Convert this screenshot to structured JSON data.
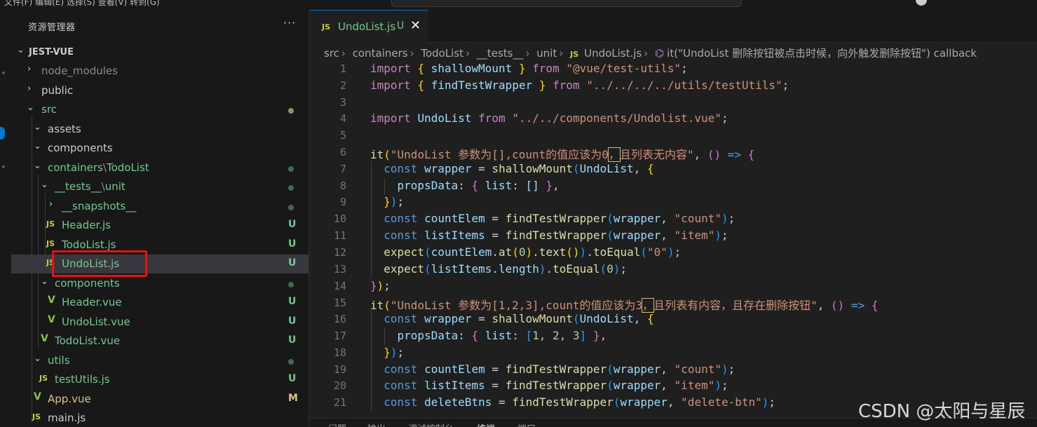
{
  "menubar": {
    "text": "文件(F)  编辑(E)  选择(S)  查看(V)  转到(G)"
  },
  "explorer": {
    "title": "资源管理器",
    "more": "···",
    "root": "JEST-VUE",
    "items": [
      {
        "label": "node_modules"
      },
      {
        "label": "public"
      },
      {
        "label": "src"
      },
      {
        "label": "assets"
      },
      {
        "label": "components"
      },
      {
        "label_a": "containers",
        "sep": "\\",
        "label_b": "TodoList"
      },
      {
        "label_a": "__tests__",
        "sep": "\\",
        "label_b": "unit"
      },
      {
        "label": "__snapshots__"
      },
      {
        "label": "Header.js",
        "status": "U"
      },
      {
        "label": "TodoList.js",
        "status": "U"
      },
      {
        "label": "UndoList.js",
        "status": "U"
      },
      {
        "label": "components"
      },
      {
        "label": "Header.vue",
        "status": "U"
      },
      {
        "label": "UndoList.vue",
        "status": "U"
      },
      {
        "label": "TodoList.vue",
        "status": "U"
      },
      {
        "label": "utils"
      },
      {
        "label": "testUtils.js",
        "status": "U"
      },
      {
        "label": "App.vue",
        "status": "M"
      },
      {
        "label": "main.js"
      }
    ],
    "js_icon": "JS",
    "vue_icon": "V"
  },
  "tab": {
    "icon": "JS",
    "name": "UndoList.js",
    "status": "U",
    "close": "✕"
  },
  "breadcrumb": {
    "parts": [
      "src",
      "containers",
      "TodoList",
      "__tests__",
      "unit"
    ],
    "file": "UndoList.js",
    "symbol": "it(\"UndoList 删除按钮被点击时候，向外触发删除按钮\") callback"
  },
  "code": {
    "line_numbers": [
      "1",
      "2",
      "3",
      "4",
      "5",
      "6",
      "7",
      "8",
      "9",
      "10",
      "11",
      "12",
      "13",
      "14",
      "15",
      "16",
      "17",
      "18",
      "19",
      "20",
      "21"
    ],
    "import": "import",
    "from": "from",
    "const": "const",
    "shallowMount": "shallowMount",
    "findTestWrapper": "findTestWrapper",
    "UndoList": "UndoList",
    "str_vue_test_utils": "\"@vue/test-utils\"",
    "str_test_utils": "\"../../../../utils/testUtils\"",
    "str_component": "\"../../components/Undolist.vue\"",
    "it1_desc_a": "\"UndoList 参数为[],count的值应该为0",
    "it1_desc_hl": "，",
    "it1_desc_b": "且列表无内容\"",
    "it2_desc_a": "\"UndoList 参数为[1,2,3],count的值应该为3",
    "it2_desc_hl": "，",
    "it2_desc_b": "且列表有内容，且存在删除按钮\"",
    "str_count": "\"count\"",
    "str_item": "\"item\"",
    "str_zero": "\"0\"",
    "str_delete_btn": "\"delete-btn\"",
    "props1": "list: []",
    "props2_list": "list:",
    "props2_vals": "1, 2, 3"
  },
  "panel_tabs": [
    "问题",
    "输出",
    "调试控制台",
    "终端",
    "端口"
  ],
  "watermark": "CSDN @太阳与星辰",
  "colors": {
    "accent": "#0078d4",
    "untracked": "#73c991",
    "modified": "#e2c08d",
    "highlight_box": "#e01414"
  }
}
